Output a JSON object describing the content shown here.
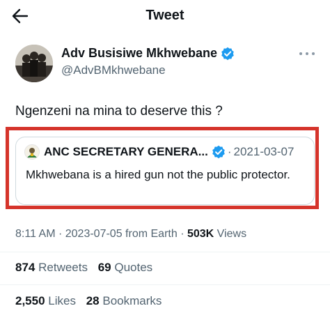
{
  "header": {
    "title": "Tweet",
    "back_icon": "arrow-left-icon"
  },
  "author": {
    "name": "Adv Busisiwe Mkhwebane",
    "handle": "@AdvBMkhwebane",
    "verified_color": "#1d9bf0"
  },
  "tweet": {
    "text": "Ngenzeni na mina to deserve this ?"
  },
  "quote": {
    "name": "ANC SECRETARY GENERA...",
    "separator": "·",
    "date": "2021-03-07",
    "text": "Mkhwebana is a hired gun not the public protector."
  },
  "meta": {
    "time": "8:11 AM",
    "sep1": "·",
    "date": "2023-07-05",
    "source": "from Earth",
    "sep2": "·",
    "views_count": "503K",
    "views_label": "Views"
  },
  "stats": {
    "retweets_count": "874",
    "retweets_label": "Retweets",
    "quotes_count": "69",
    "quotes_label": "Quotes",
    "likes_count": "2,550",
    "likes_label": "Likes",
    "bookmarks_count": "28",
    "bookmarks_label": "Bookmarks"
  },
  "colors": {
    "highlight": "#d5342b",
    "secondary_text": "#536471"
  }
}
